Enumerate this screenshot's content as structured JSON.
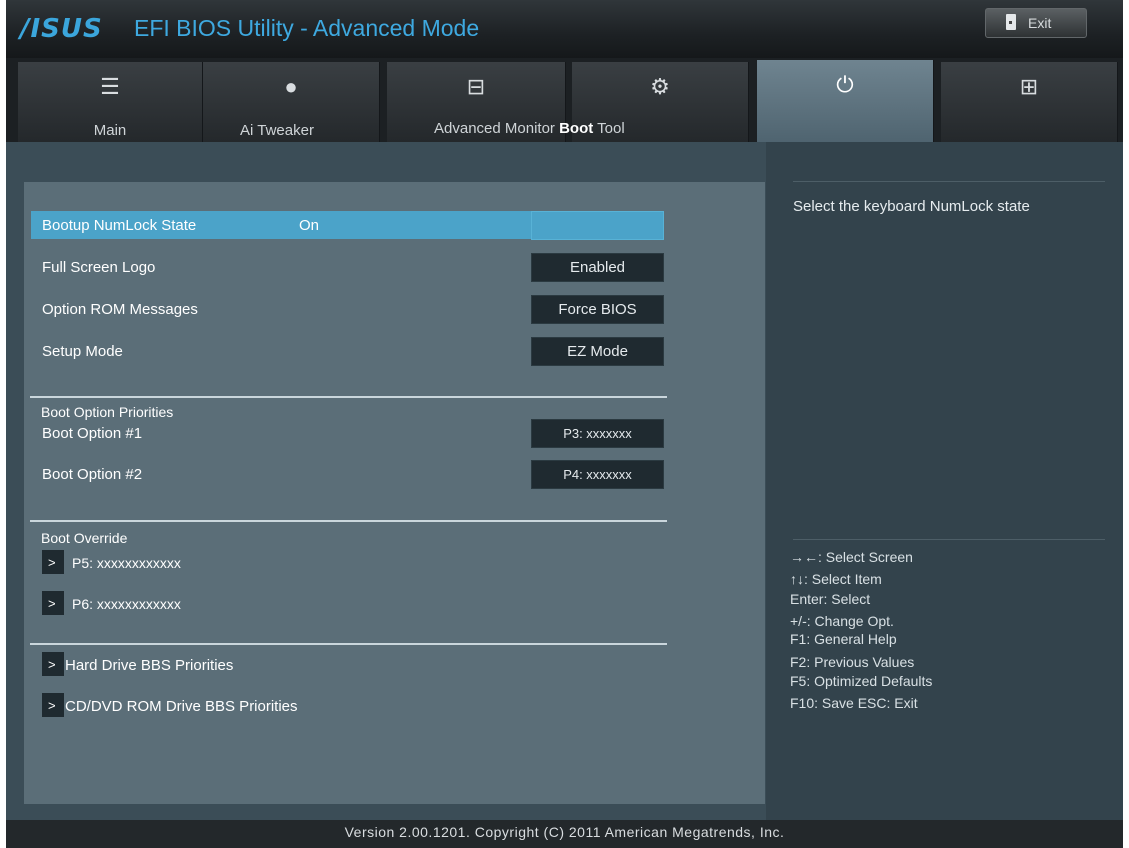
{
  "header": {
    "logo_text": "/ISUS",
    "title": "EFI BIOS Utility - Advanced Mode",
    "exit_label": "Exit"
  },
  "tabs": [
    {
      "label": "Main",
      "icon": "list-icon"
    },
    {
      "label": "Ai  Tweaker",
      "icon": "tweaker-icon"
    },
    {
      "label": "Advanced",
      "icon": "advanced-icon"
    },
    {
      "label": "Monitor",
      "icon": "monitor-icon"
    },
    {
      "label": "Boot",
      "icon": "power-icon"
    },
    {
      "label": "Tool",
      "icon": "tool-icon"
    }
  ],
  "tab_strip_text": {
    "advanced": "Advanced",
    "monitor": "Monitor",
    "boot": "Boot",
    "tool": "Tool"
  },
  "settings": [
    {
      "label": "Bootup NumLock State",
      "value": "On",
      "selected": true
    },
    {
      "label": "Full Screen Logo",
      "value": "Enabled"
    },
    {
      "label": "Option ROM Messages",
      "value": "Force BIOS"
    },
    {
      "label": "Setup Mode",
      "value": "EZ Mode"
    }
  ],
  "boot_priorities": {
    "title": "Boot Option Priorities",
    "options": [
      {
        "label": "Boot Option #1",
        "value": "P3:  xxxxxxx"
      },
      {
        "label": "Boot Option #2",
        "value": "P4:  xxxxxxx"
      }
    ]
  },
  "boot_override": {
    "title": "Boot Override",
    "items": [
      "P5:  xxxxxxxxxxxx",
      "P6:  xxxxxxxxxxxx"
    ]
  },
  "submenus": [
    "Hard Drive BBS Priorities",
    "CD/DVD ROM Drive BBS Priorities"
  ],
  "arrow": ">",
  "help": {
    "description": "Select the keyboard NumLock state",
    "keys": [
      "→←: Select Screen",
      "↑↓: Select Item",
      "Enter: Select",
      "+/-: Change Opt.",
      "F1: General Help",
      "F2: Previous Values",
      "F5: Optimized Defaults",
      "F10: Save   ESC: Exit"
    ]
  },
  "footer": "Version  2.00.1201.  Copyright  (C)  2011  American  Megatrends,  Inc.",
  "colors": {
    "accent": "#3ea9e0",
    "selection": "#4ba3c9",
    "panel": "#5b6e78",
    "value_box": "#1f2a30"
  }
}
